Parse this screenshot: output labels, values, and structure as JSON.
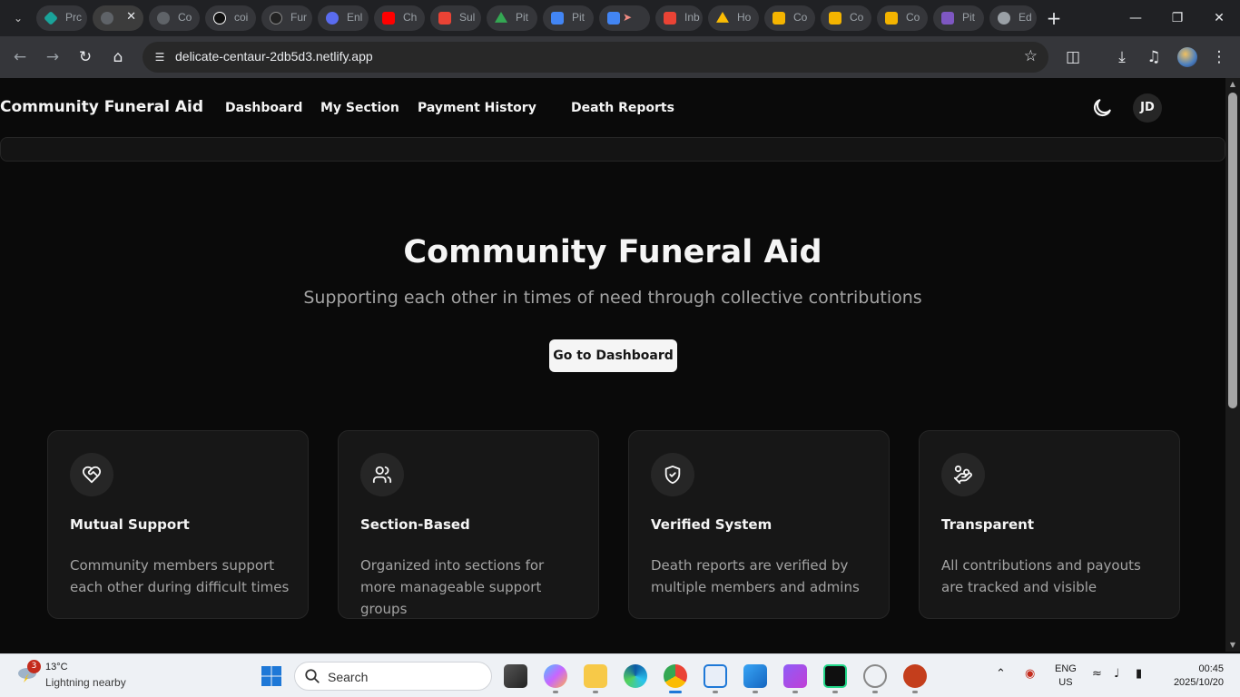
{
  "browser": {
    "tabs": [
      {
        "title": "Prc",
        "color": "#1aa39a"
      },
      {
        "title": "",
        "color": "#5f6368",
        "active": true
      },
      {
        "title": "Co",
        "color": "#5f6368"
      },
      {
        "title": "coi",
        "color": "#111111"
      },
      {
        "title": "Fur",
        "color": "#222222"
      },
      {
        "title": "Enl",
        "color": "#5a6cf0"
      },
      {
        "title": "Ch",
        "color": "#ff0000"
      },
      {
        "title": "Sul",
        "color": "#ea4335"
      },
      {
        "title": "Pit",
        "color": "#34a853"
      },
      {
        "title": "Pit",
        "color": "#4285f4"
      },
      {
        "title": "",
        "color": "#4285f4"
      },
      {
        "title": "Inb",
        "color": "#ea4335"
      },
      {
        "title": "Ho",
        "color": "#fbbc04"
      },
      {
        "title": "Co",
        "color": "#f4b400"
      },
      {
        "title": "Co",
        "color": "#f4b400"
      },
      {
        "title": "Co",
        "color": "#f4b400"
      },
      {
        "title": "Pit",
        "color": "#7e57c2"
      },
      {
        "title": "Ed",
        "color": "#9aa0a6"
      }
    ],
    "url": "delicate-centaur-2db5d3.netlify.app"
  },
  "app": {
    "brand": "Community Funeral Aid",
    "nav": [
      "Dashboard",
      "My Section",
      "Payment History",
      "Death Reports"
    ],
    "avatar_initials": "JD",
    "hero_title": "Community Funeral Aid",
    "hero_subtitle": "Supporting each other in times of need through collective contributions",
    "cta_label": "Go to Dashboard",
    "features": [
      {
        "title": "Mutual Support",
        "desc": "Community members support each other during difficult times",
        "icon": "heart-handshake-icon"
      },
      {
        "title": "Section-Based",
        "desc": "Organized into sections for more manageable support groups",
        "icon": "users-icon"
      },
      {
        "title": "Verified System",
        "desc": "Death reports are verified by multiple members and admins",
        "icon": "shield-check-icon"
      },
      {
        "title": "Transparent",
        "desc": "All contributions and payouts are tracked and visible",
        "icon": "hand-coins-icon"
      }
    ]
  },
  "taskbar": {
    "weather_badge": "3",
    "weather_temp": "13°C",
    "weather_desc": "Lightning nearby",
    "search_label": "Search",
    "lang_line1": "ENG",
    "lang_line2": "US",
    "time": "00:45",
    "date": "2025/10/20"
  }
}
